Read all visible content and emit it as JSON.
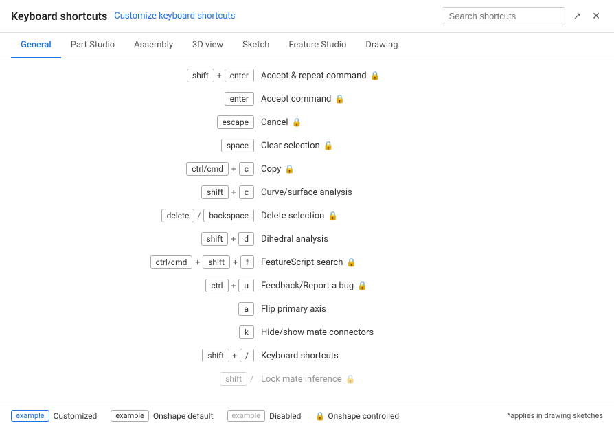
{
  "header": {
    "title": "Keyboard shortcuts",
    "customize_link": "Customize keyboard shortcuts",
    "search_placeholder": "Search shortcuts"
  },
  "tabs": [
    {
      "id": "general",
      "label": "General",
      "active": true
    },
    {
      "id": "part-studio",
      "label": "Part Studio",
      "active": false
    },
    {
      "id": "assembly",
      "label": "Assembly",
      "active": false
    },
    {
      "id": "3d-view",
      "label": "3D view",
      "active": false
    },
    {
      "id": "sketch",
      "label": "Sketch",
      "active": false
    },
    {
      "id": "feature-studio",
      "label": "Feature Studio",
      "active": false
    },
    {
      "id": "drawing",
      "label": "Drawing",
      "active": false
    }
  ],
  "shortcuts": [
    {
      "keys": [
        {
          "key": "shift"
        },
        {
          "sep": "+"
        },
        {
          "key": "enter"
        }
      ],
      "action": "Accept & repeat command",
      "locked": true
    },
    {
      "keys": [
        {
          "key": "enter"
        }
      ],
      "action": "Accept command",
      "locked": true
    },
    {
      "keys": [
        {
          "key": "escape"
        }
      ],
      "action": "Cancel",
      "locked": true
    },
    {
      "keys": [
        {
          "key": "space"
        }
      ],
      "action": "Clear selection",
      "locked": true
    },
    {
      "keys": [
        {
          "key": "ctrl/cmd"
        },
        {
          "sep": "+"
        },
        {
          "key": "c"
        }
      ],
      "action": "Copy",
      "locked": true
    },
    {
      "keys": [
        {
          "key": "shift"
        },
        {
          "sep": "+"
        },
        {
          "key": "c"
        }
      ],
      "action": "Curve/surface analysis",
      "locked": false
    },
    {
      "keys": [
        {
          "key": "delete"
        },
        {
          "sep": "/"
        },
        {
          "key": "backspace"
        }
      ],
      "action": "Delete selection",
      "locked": true
    },
    {
      "keys": [
        {
          "key": "shift"
        },
        {
          "sep": "+"
        },
        {
          "key": "d"
        }
      ],
      "action": "Dihedral analysis",
      "locked": false
    },
    {
      "keys": [
        {
          "key": "ctrl/cmd"
        },
        {
          "sep": "+"
        },
        {
          "key": "shift"
        },
        {
          "sep": "+"
        },
        {
          "key": "f"
        }
      ],
      "action": "FeatureScript search",
      "locked": true
    },
    {
      "keys": [
        {
          "key": "ctrl"
        },
        {
          "sep": "+"
        },
        {
          "key": "u"
        }
      ],
      "action": "Feedback/Report a bug",
      "locked": true
    },
    {
      "keys": [
        {
          "key": "a"
        }
      ],
      "action": "Flip primary axis",
      "locked": false
    },
    {
      "keys": [
        {
          "key": "k"
        }
      ],
      "action": "Hide/show mate connectors",
      "locked": false
    },
    {
      "keys": [
        {
          "key": "shift"
        },
        {
          "sep": "+"
        },
        {
          "key": "/"
        }
      ],
      "action": "Keyboard shortcuts",
      "locked": false
    },
    {
      "keys": [
        {
          "key": "shift"
        },
        {
          "sep": "+"
        },
        {
          "key": "..."
        }
      ],
      "action": "Lock mate inference",
      "locked": true,
      "partial": true
    }
  ],
  "legend": {
    "customized_label": "Customized",
    "customized_key": "example",
    "default_label": "Onshape default",
    "default_key": "example",
    "disabled_label": "Disabled",
    "disabled_key": "example",
    "controlled_label": "Onshape controlled",
    "note": "*applies in drawing sketches"
  }
}
